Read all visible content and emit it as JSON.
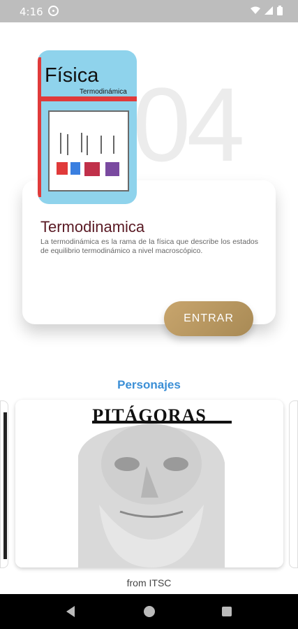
{
  "status_bar": {
    "time": "4:16",
    "icons": [
      "sync-icon",
      "wifi-icon",
      "signal-icon",
      "battery-icon"
    ]
  },
  "background_number": "04",
  "book_cover": {
    "title": "Física",
    "subtitle": "Termodinámica"
  },
  "card": {
    "title": "Termodinamica",
    "description": "La termodinámica es la rama de la física que describe los estados de equilibrio termodinámico a nivel macroscópico.",
    "button_label": "ENTRAR"
  },
  "section_title": "Personajes",
  "carousel": {
    "current_label": "PITÁGORAS"
  },
  "footer_text": "from ITSC",
  "nav": {
    "icons": [
      "back-icon",
      "home-icon",
      "recents-icon"
    ]
  },
  "colors": {
    "accent_blue": "#3b8fd6",
    "button_gold": "#c8a56d",
    "title_maroon": "#5a1a24",
    "book_blue": "#8fd3ec",
    "book_red": "#e03a3a"
  }
}
